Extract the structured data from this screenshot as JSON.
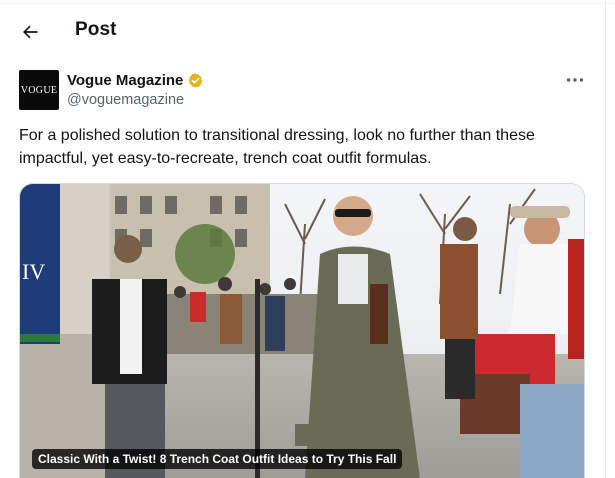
{
  "header": {
    "back_icon": "arrow-left-icon",
    "title": "Post"
  },
  "post": {
    "avatar_text": "VOGUE",
    "author_name": "Vogue Magazine",
    "verified_icon": "verified-badge-icon",
    "verified_color": "#e8b11e",
    "handle": "@voguemagazine",
    "more_icon": "more-horizontal-icon",
    "text": "For a polished solution to transitional dressing, look no further than these impactful, yet easy-to-recreate, trench coat outfit formulas.",
    "media": {
      "caption": "Classic With a Twist! 8 Trench Coat Outfit Ideas to Try This Fall",
      "sign_text": "RD IV"
    }
  },
  "colors": {
    "text": "#0f1419",
    "secondary": "#536471",
    "border": "#cfd9de"
  }
}
